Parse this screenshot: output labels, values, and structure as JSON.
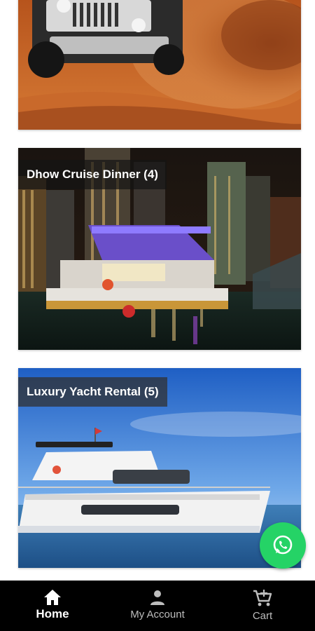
{
  "cards": [
    {
      "label": ""
    },
    {
      "label": "Dhow Cruise Dinner (4)"
    },
    {
      "label": "Luxury Yacht Rental (5)"
    }
  ],
  "fab": {
    "icon": "whatsapp-icon",
    "color": "#25d366"
  },
  "nav": {
    "home": {
      "label": "Home",
      "icon": "home-icon"
    },
    "account": {
      "label": "My Account",
      "icon": "person-icon"
    },
    "cart": {
      "label": "Cart",
      "icon": "cart-icon"
    }
  },
  "colors": {
    "nav_bg": "#000000",
    "nav_active": "#ffffff",
    "nav_inactive": "#bdbdbd"
  }
}
